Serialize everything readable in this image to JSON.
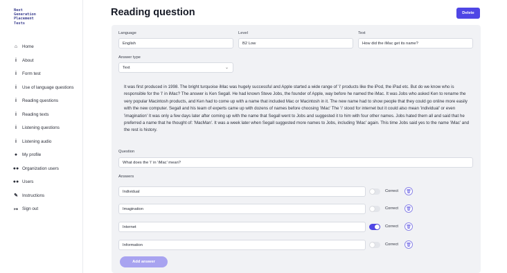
{
  "logo": {
    "lines": [
      "Next",
      "Generation",
      "Placement",
      "Tests"
    ]
  },
  "sidebar": {
    "items": [
      {
        "label": "Home",
        "icon": "home-icon",
        "glyph": "⌂"
      },
      {
        "label": "About",
        "icon": "info-icon",
        "glyph": "i"
      },
      {
        "label": "Form test",
        "icon": "info-icon",
        "glyph": "i"
      },
      {
        "label": "Use of language questions",
        "icon": "info-icon",
        "glyph": "i"
      },
      {
        "label": "Reading questions",
        "icon": "info-icon",
        "glyph": "i"
      },
      {
        "label": "Reading texts",
        "icon": "info-icon",
        "glyph": "i"
      },
      {
        "label": "Listening questions",
        "icon": "info-icon",
        "glyph": "i"
      },
      {
        "label": "Listening audio",
        "icon": "info-icon",
        "glyph": "i"
      },
      {
        "label": "My profile",
        "icon": "user-icon",
        "glyph": "●"
      },
      {
        "label": "Organization users",
        "icon": "users-icon",
        "glyph": "●●"
      },
      {
        "label": "Users",
        "icon": "users-icon",
        "glyph": "●●"
      },
      {
        "label": "Instructions",
        "icon": "wrench-icon",
        "glyph": "✎"
      },
      {
        "label": "Sign out",
        "icon": "sign-out-icon",
        "glyph": "↦"
      }
    ]
  },
  "header": {
    "title": "Reading question",
    "delete_label": "Delete"
  },
  "form": {
    "language": {
      "label": "Language",
      "value": "English"
    },
    "level": {
      "label": "Level",
      "value": "B2 Low"
    },
    "text": {
      "label": "Text",
      "value": "How did the iMac get its name?"
    },
    "answer_type": {
      "label": "Answer type",
      "value": "Text"
    },
    "passage": "It was first produced in 1998. The bright turquoise iMac was hugely successful and Apple started a wide range of 'i' products like the iPod, the iPad etc. But do we know who is responsible for the 'i' in iMac? The answer is Ken Segall. He had known Steve Jobs, the founder of Apple, way before he named the iMac. It was Jobs who asked Ken to rename the very popular Macintosh products, and Ken had to come up with a name that included Mac or Macintosh in it. The new name had to show people that they could go online more easily with the new computer. Segall and his team of experts came up with dozens of names before choosing 'iMac' The 'i' stood for internet but it could also mean 'individual' or even 'imagination' It was only a few days later after coming up with the name that Segall went to Jobs and suggested it to him with four other names. Jobs hated them all and said that he preferred a name that he thought of: 'MacMan'. It was a week later when Segall suggested more names to Jobs, including 'iMac' again. This time Jobs said yes to the name 'iMac' and the rest is history.",
    "question": {
      "label": "Question",
      "value": "What does the 'i' in 'iMac' mean?"
    },
    "answers_label": "Answers",
    "correct_label": "Correct",
    "answers": [
      {
        "value": "Individual",
        "correct": false
      },
      {
        "value": "Imagination",
        "correct": false
      },
      {
        "value": "Internet",
        "correct": true
      },
      {
        "value": "Information",
        "correct": false
      }
    ],
    "add_answer_label": "Add answer"
  },
  "colors": {
    "accent": "#4f46e5",
    "accent_light": "#a8a3f0",
    "panel": "#f1f2f5"
  }
}
